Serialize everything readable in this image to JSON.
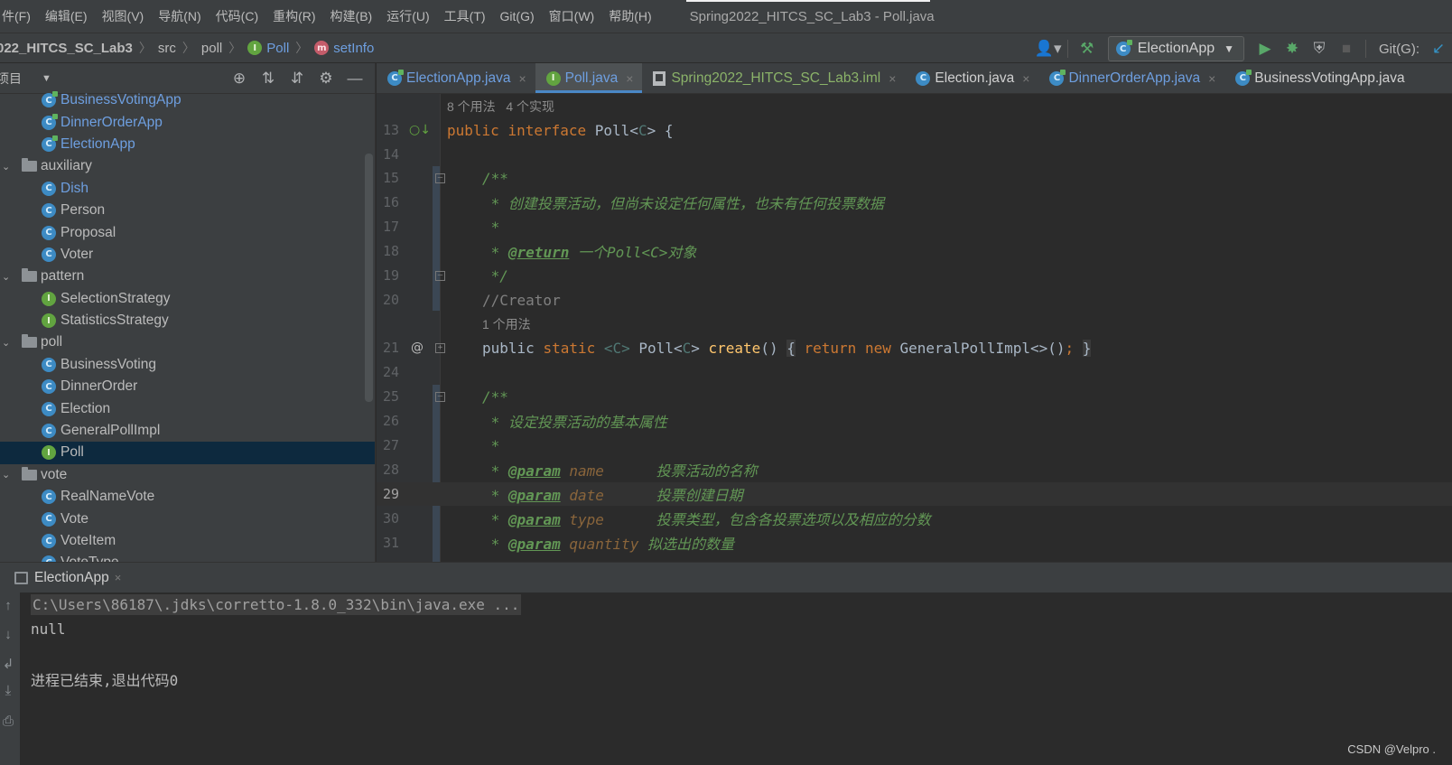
{
  "menubar": {
    "items": [
      "件(F)",
      "编辑(E)",
      "视图(V)",
      "导航(N)",
      "代码(C)",
      "重构(R)",
      "构建(B)",
      "运行(U)",
      "工具(T)",
      "Git(G)",
      "窗口(W)",
      "帮助(H)"
    ],
    "window_title": "Spring2022_HITCS_SC_Lab3 - Poll.java"
  },
  "navbar": {
    "project": "022_HITCS_SC_Lab3",
    "src": "src",
    "pkg": "poll",
    "cls": "Poll",
    "method": "setInfo",
    "run_config": "ElectionApp",
    "git_label": "Git(G):"
  },
  "project_panel": {
    "title": "项目",
    "tree": [
      {
        "label": "BusinessVotingApp",
        "icon": "class-app-icon",
        "depth": 2,
        "color": "blue"
      },
      {
        "label": "DinnerOrderApp",
        "icon": "class-app-icon",
        "depth": 2,
        "color": "blue"
      },
      {
        "label": "ElectionApp",
        "icon": "class-app-icon",
        "depth": 2,
        "color": "blue"
      },
      {
        "label": "auxiliary",
        "icon": "folder-icon",
        "depth": 1,
        "expanded": true
      },
      {
        "label": "Dish",
        "icon": "class-icon",
        "depth": 2,
        "color": "blue"
      },
      {
        "label": "Person",
        "icon": "class-icon",
        "depth": 2
      },
      {
        "label": "Proposal",
        "icon": "class-icon",
        "depth": 2
      },
      {
        "label": "Voter",
        "icon": "class-icon",
        "depth": 2
      },
      {
        "label": "pattern",
        "icon": "folder-icon",
        "depth": 1,
        "expanded": true
      },
      {
        "label": "SelectionStrategy",
        "icon": "interface-icon",
        "depth": 2
      },
      {
        "label": "StatisticsStrategy",
        "icon": "interface-icon",
        "depth": 2
      },
      {
        "label": "poll",
        "icon": "folder-icon",
        "depth": 1,
        "expanded": true
      },
      {
        "label": "BusinessVoting",
        "icon": "class-icon",
        "depth": 2
      },
      {
        "label": "DinnerOrder",
        "icon": "class-icon",
        "depth": 2
      },
      {
        "label": "Election",
        "icon": "class-icon",
        "depth": 2
      },
      {
        "label": "GeneralPollImpl",
        "icon": "class-icon",
        "depth": 2
      },
      {
        "label": "Poll",
        "icon": "interface-icon",
        "depth": 2,
        "selected": true
      },
      {
        "label": "vote",
        "icon": "folder-icon",
        "depth": 1,
        "expanded": true
      },
      {
        "label": "RealNameVote",
        "icon": "class-icon",
        "depth": 2
      },
      {
        "label": "Vote",
        "icon": "class-icon",
        "depth": 2
      },
      {
        "label": "VoteItem",
        "icon": "class-icon",
        "depth": 2
      },
      {
        "label": "VoteType",
        "icon": "class-icon",
        "depth": 2
      }
    ]
  },
  "editor_tabs": [
    {
      "label": "ElectionApp.java",
      "icon": "class-app-icon",
      "style": "blue"
    },
    {
      "label": "Poll.java",
      "icon": "interface-icon",
      "style": "active"
    },
    {
      "label": "Spring2022_HITCS_SC_Lab3.iml",
      "icon": "iml-file-icon",
      "style": "green"
    },
    {
      "label": "Election.java",
      "icon": "class-icon",
      "style": "white"
    },
    {
      "label": "DinnerOrderApp.java",
      "icon": "class-app-icon",
      "style": "blue"
    },
    {
      "label": "BusinessVotingApp.java",
      "icon": "class-app-icon",
      "style": "white"
    }
  ],
  "editor": {
    "usage_hint_top": "8 个用法   4 个实现",
    "usage_hint_create": "1 个用法",
    "line_numbers": [
      "13",
      "14",
      "15",
      "16",
      "17",
      "18",
      "19",
      "20",
      "21",
      "24",
      "25",
      "26",
      "27",
      "28",
      "29",
      "30",
      "31"
    ],
    "line13": {
      "kw1": "public",
      "kw2": "interface",
      "name": "Poll<",
      "tp": "C",
      "rest": "> {"
    },
    "line15": "/**",
    "line16": " * 创建投票活动，但尚未设定任何属性，也未有任何投票数据",
    "line17": " *",
    "line18": {
      "star": " * ",
      "tag": "@return",
      "text": " 一个Poll<C>对象"
    },
    "line19": " */",
    "line20": "//Creator",
    "line21": {
      "kw1": "public",
      "kw2": "static",
      "tp1": "<C>",
      "type": "Poll<",
      "tp2": "C",
      "type_end": ">",
      "fn": "create",
      "paren": "()",
      "ob": "{",
      "kw3": "return",
      "kw4": "new",
      "ctor": "GeneralPollImpl<>()",
      "semi": ";",
      "cb": "}"
    },
    "line25": "/**",
    "line26": " * 设定投票活动的基本属性",
    "line27": " *",
    "line28": {
      "star": " * ",
      "tag": "@param",
      "name": " name      ",
      "text": "投票活动的名称"
    },
    "line29": {
      "star": " * ",
      "tag": "@param",
      "name": " date      ",
      "text": "投票创建日期"
    },
    "line30": {
      "star": " * ",
      "tag": "@param",
      "name": " type      ",
      "text": "投票类型，包含各投票选项以及相应的分数"
    },
    "line31": {
      "star": " * ",
      "tag": "@param",
      "name": " quantity ",
      "text": "拟选出的数量"
    }
  },
  "run_panel": {
    "tab_label": "ElectionApp",
    "console": [
      "C:\\Users\\86187\\.jdks\\corretto-1.8.0_332\\bin\\java.exe ...",
      "null",
      "",
      "进程已结束,退出代码0"
    ]
  },
  "watermark": "CSDN @Velpro ."
}
